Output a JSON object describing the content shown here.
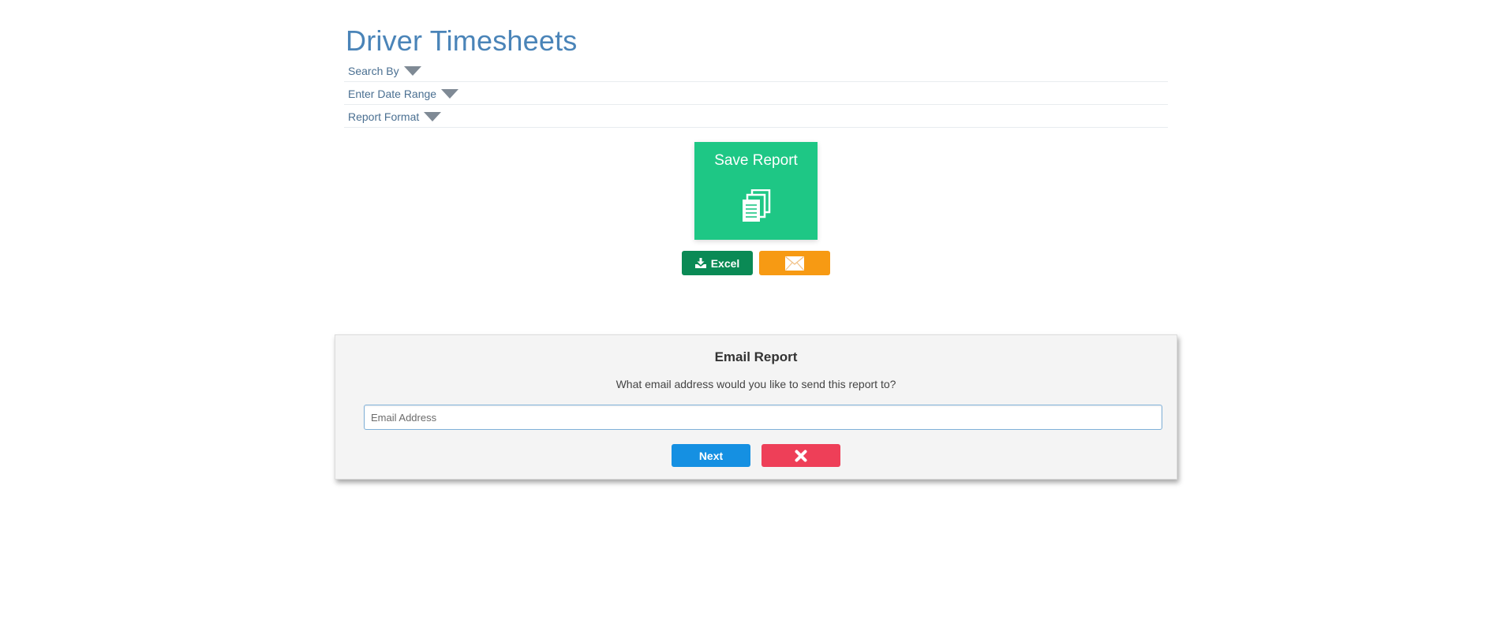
{
  "page": {
    "title": "Driver Timesheets"
  },
  "sections": [
    {
      "label": "Search By"
    },
    {
      "label": "Enter Date Range"
    },
    {
      "label": "Report Format"
    }
  ],
  "save_report": {
    "label": "Save Report",
    "icon": "documents-icon",
    "color": "#1ec785"
  },
  "actions": {
    "excel_label": "Excel",
    "excel_icon": "download-icon",
    "excel_color": "#0a8a55",
    "email_icon": "envelope-icon",
    "email_color": "#f79a13"
  },
  "email_dialog": {
    "title": "Email Report",
    "question": "What email address would you like to send this report to?",
    "email_value": "",
    "email_placeholder": "Email Address",
    "next_label": "Next",
    "next_color": "#1590e2",
    "cancel_icon": "close-icon",
    "cancel_color": "#ee3f58"
  }
}
